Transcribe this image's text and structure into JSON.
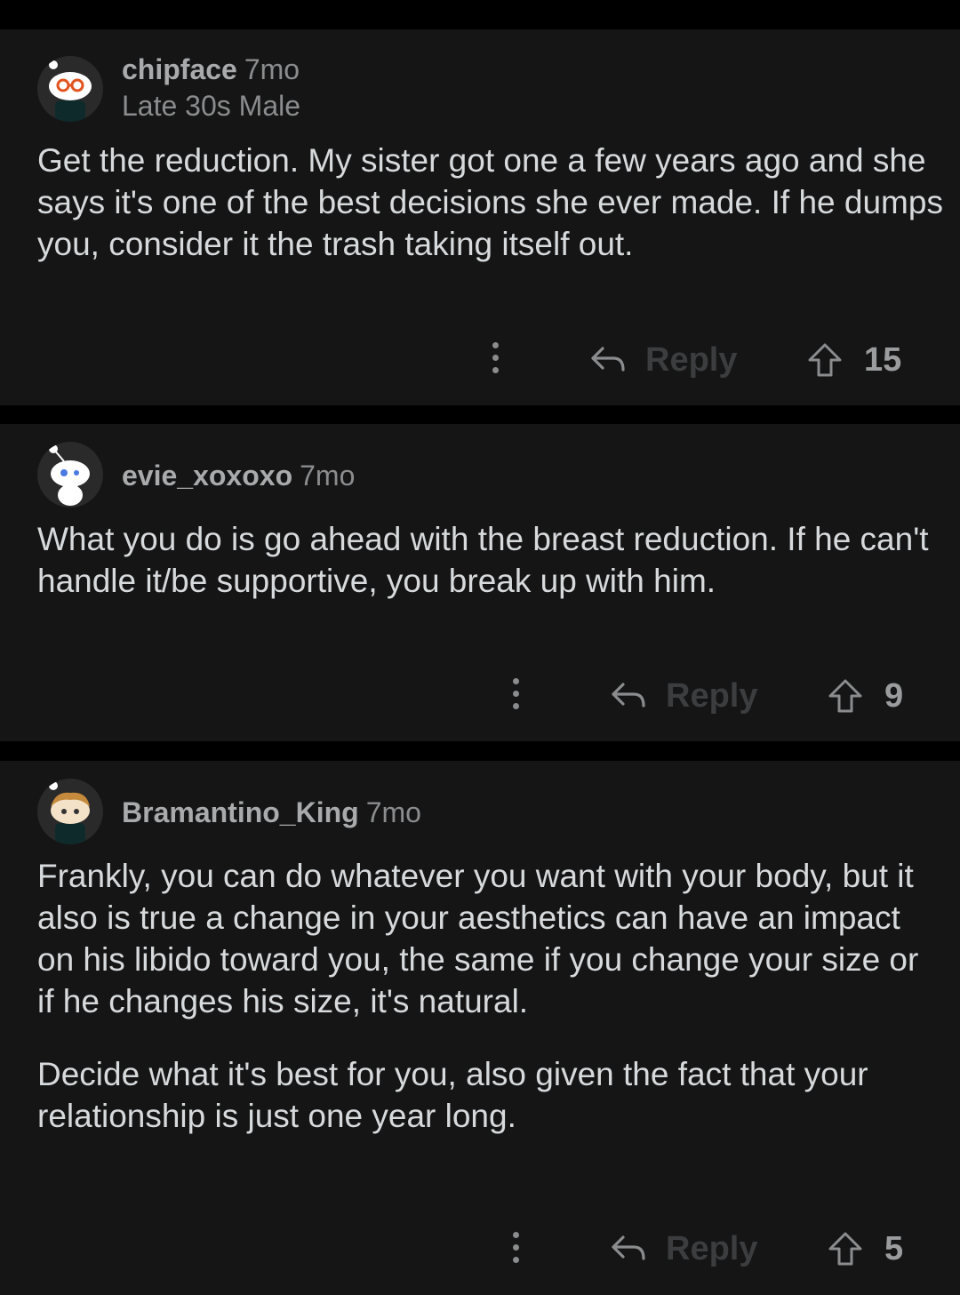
{
  "comments": [
    {
      "username": "chipface",
      "age": "7mo",
      "flair": "Late 30s Male",
      "avatar_icon": "snoo-avatar-glasses-icon",
      "paragraphs": [
        "Get the reduction. My sister got one a few years ago and she says it's one of the best decisions she ever made. If he dumps you, consider it the trash taking itself out."
      ],
      "reply_label": "Reply",
      "score": "15"
    },
    {
      "username": "evie_xoxoxo",
      "age": "7mo",
      "flair": "",
      "avatar_icon": "snoo-avatar-default-icon",
      "paragraphs": [
        "What you do is go ahead with the breast reduction. If he can't handle it/be supportive, you break up with him."
      ],
      "reply_label": "Reply",
      "score": "9"
    },
    {
      "username": "Bramantino_King",
      "age": "7mo",
      "flair": "",
      "avatar_icon": "snoo-avatar-hair-icon",
      "paragraphs": [
        "Frankly, you can do whatever you want with your body, but it also is true a change in your aesthetics can have an impact on his libido toward you, the same if you change your size or if he changes his size, it's natural.",
        "Decide what it's best for you, also given the fact that your relationship is just one year long."
      ],
      "reply_label": "Reply",
      "score": "5"
    }
  ],
  "colors": {
    "background": "#000000",
    "card": "#151515",
    "text": "#d7dadc",
    "meta": "#8a8c8e",
    "reply_dim": "#3b3d3f"
  }
}
